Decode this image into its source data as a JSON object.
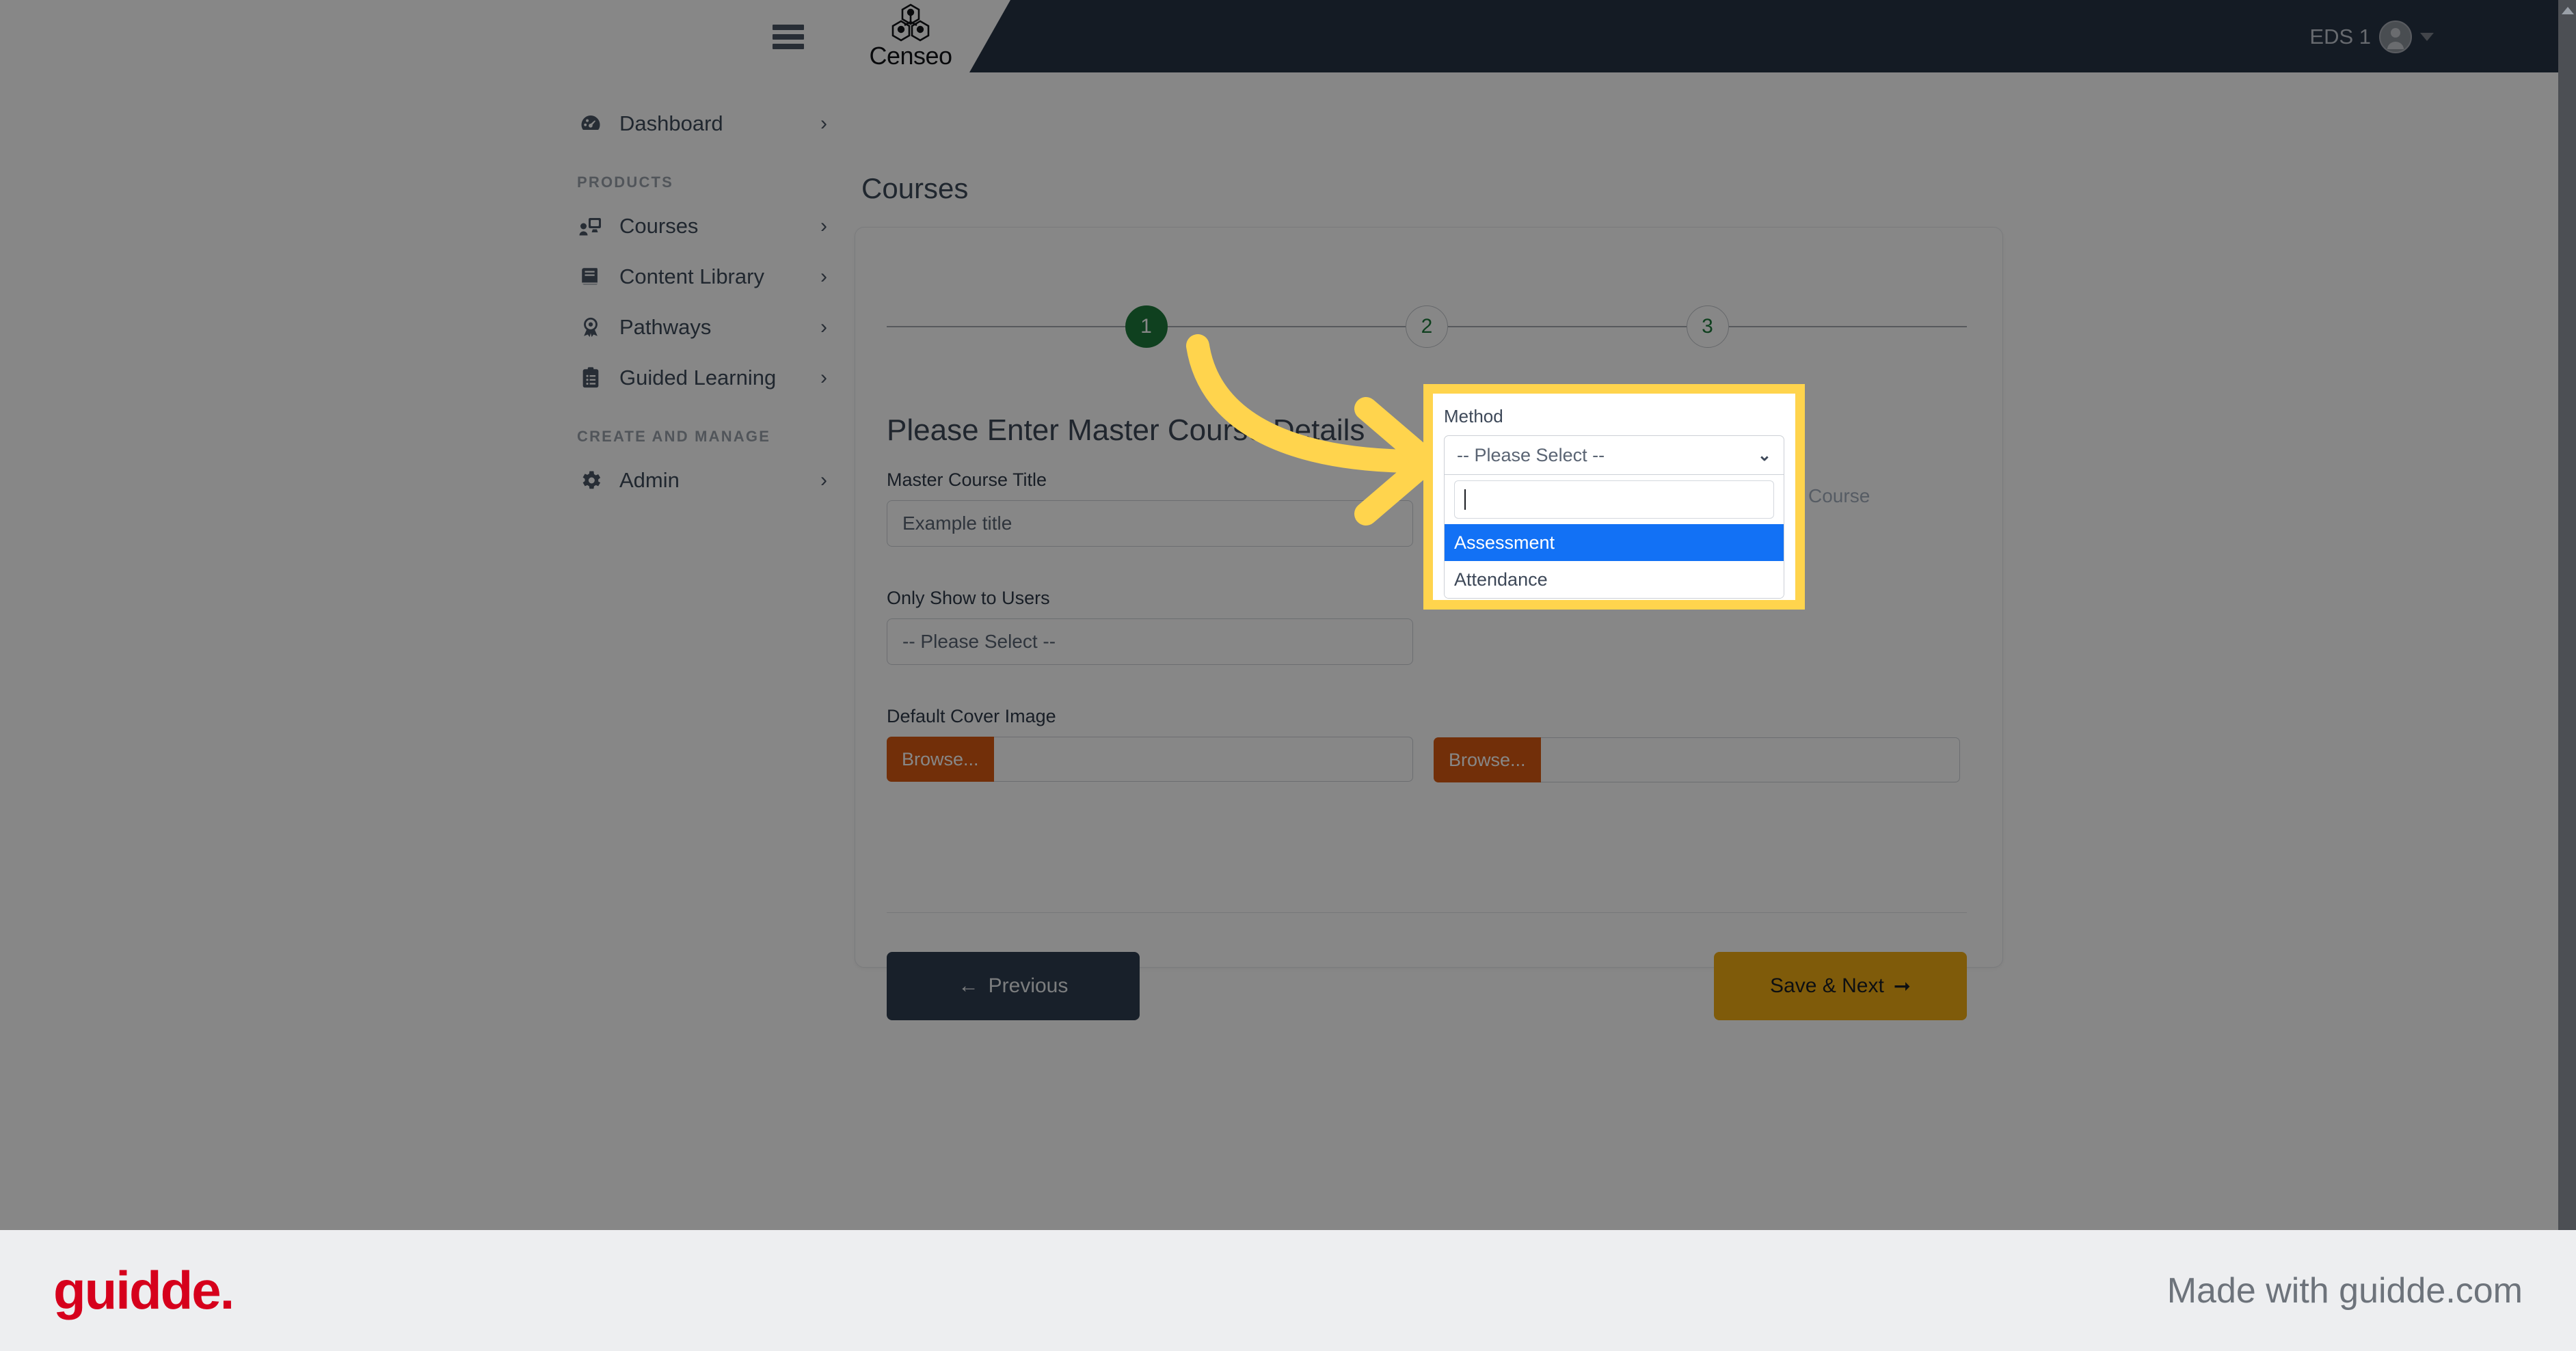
{
  "topbar": {
    "menu_icon": "hamburger-icon",
    "brand_name": "Censeo",
    "brand_icon": "censeo-hexagon-logo",
    "user_name": "EDS 1",
    "avatar_icon": "user-avatar-icon",
    "caret_icon": "chevron-down-icon"
  },
  "sidebar": {
    "items": [
      {
        "label": "Dashboard",
        "icon": "dashboard-gauge-icon",
        "chevron": "›"
      }
    ],
    "sections": [
      {
        "title": "PRODUCTS",
        "items": [
          {
            "label": "Courses",
            "icon": "courses-screen-icon",
            "chevron": "›"
          },
          {
            "label": "Content Library",
            "icon": "book-icon",
            "chevron": "›"
          },
          {
            "label": "Pathways",
            "icon": "award-ribbon-icon",
            "chevron": "›"
          },
          {
            "label": "Guided Learning",
            "icon": "clipboard-list-icon",
            "chevron": "›"
          }
        ]
      },
      {
        "title": "CREATE AND MANAGE",
        "items": [
          {
            "label": "Admin",
            "icon": "gear-icon",
            "chevron": "›"
          }
        ]
      }
    ]
  },
  "main": {
    "page_title": "Courses",
    "stepper": {
      "steps": [
        {
          "number": "1",
          "state": "done"
        },
        {
          "number": "2",
          "state": "todo"
        },
        {
          "number": "3",
          "state": "todo"
        }
      ]
    },
    "form": {
      "heading": "Please Enter Master Course Details",
      "left_fields": [
        {
          "label": "Master Course Title",
          "value": "Example title",
          "type": "text"
        },
        {
          "label": "Only Show to Users",
          "value": "-- Please Select --",
          "type": "select"
        },
        {
          "label": "Default Cover Image",
          "value": "",
          "type": "file",
          "browse_label": "Browse..."
        }
      ],
      "right_fields": [
        {
          "label": "Course",
          "value": "",
          "type": "file",
          "browse_label": "Browse..."
        }
      ]
    },
    "buttons": {
      "previous": "Previous",
      "previous_icon": "arrow-left-icon",
      "save_next": "Save & Next",
      "save_next_icon": "arrow-right-icon"
    }
  },
  "highlight": {
    "label": "Method",
    "selected_value": "-- Please Select --",
    "chevron_icon": "chevron-down-icon",
    "search_value": "",
    "options": [
      {
        "label": "Assessment",
        "state": "active"
      },
      {
        "label": "Attendance",
        "state": "plain"
      }
    ],
    "border_color": "#ffd44d",
    "active_color": "#1271f5"
  },
  "annotation": {
    "arrow_icon": "curved-arrow-right-icon",
    "arrow_color": "#ffd44d"
  },
  "footer": {
    "logo_text": "guidde.",
    "logo_color": "#d6001c",
    "made_with": "Made with guidde.com"
  }
}
